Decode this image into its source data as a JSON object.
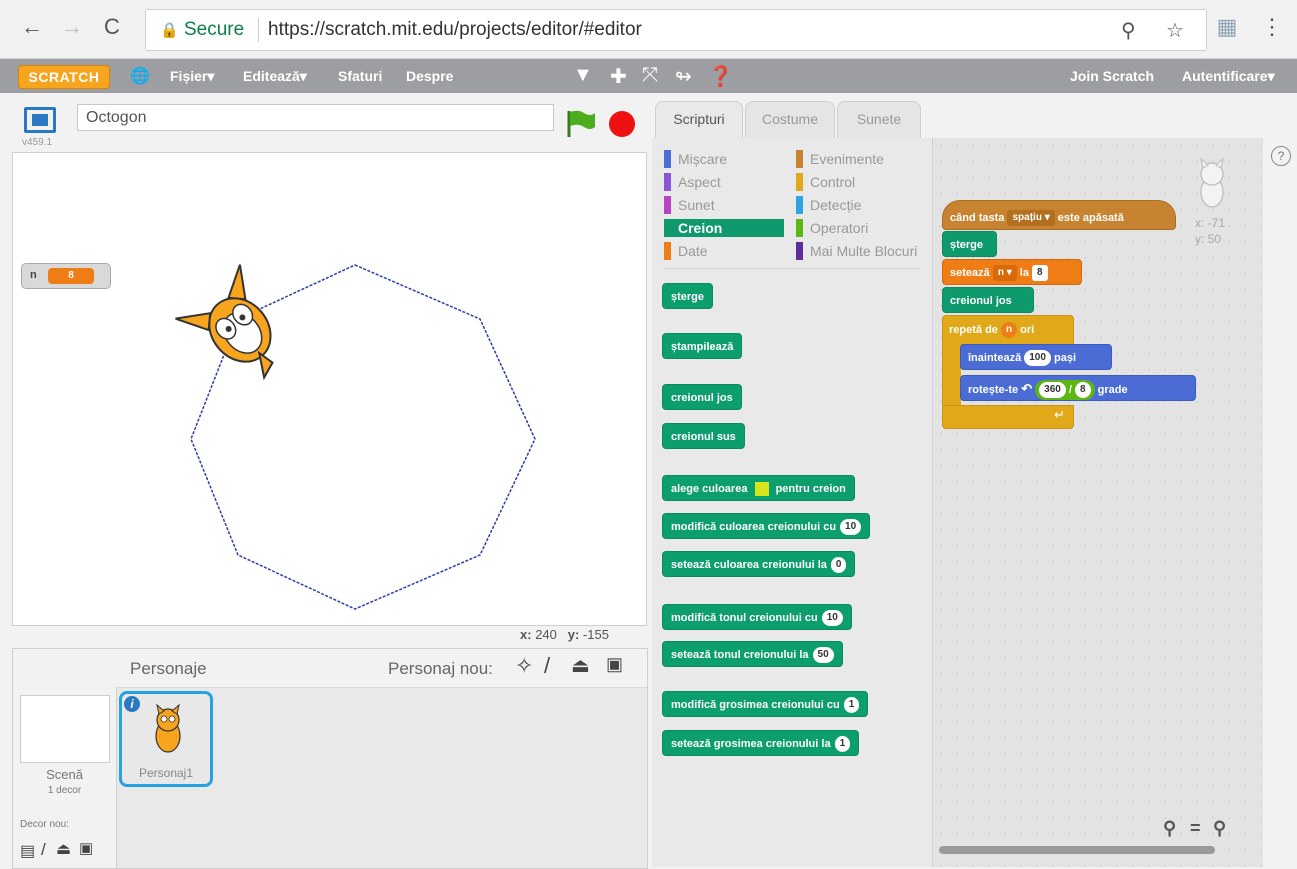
{
  "browser": {
    "back": "←",
    "forward": "→",
    "reload": "C",
    "secure_label": "Secure",
    "url": "https://scratch.mit.edu/projects/editor/#editor"
  },
  "menubar": {
    "logo": "SCRATCH",
    "items": [
      "Fișier▾",
      "Editează▾",
      "Sfaturi",
      "Despre"
    ],
    "join": "Join Scratch",
    "login": "Autentificare▾"
  },
  "stage": {
    "version": "v459.1",
    "project_title": "Octogon",
    "variable_name": "n",
    "variable_value": "8",
    "mouse_x_label": "x:",
    "mouse_x": "240",
    "mouse_y_label": "y:",
    "mouse_y": "-155"
  },
  "sprites": {
    "header": "Personaje",
    "new_sprite_label": "Personaj nou:",
    "scene_label": "Scenă",
    "scene_sub": "1 decor",
    "new_backdrop": "Decor nou:",
    "sprite_name": "Personaj1"
  },
  "tabs": [
    "Scripturi",
    "Costume",
    "Sunete"
  ],
  "categories": {
    "left": [
      "Mișcare",
      "Aspect",
      "Sunet",
      "Creion",
      "Date"
    ],
    "right": [
      "Evenimente",
      "Control",
      "Detecție",
      "Operatori",
      "Mai Multe Blocuri"
    ],
    "colors": {
      "Mișcare": "#4a6cd4",
      "Aspect": "#8a55d7",
      "Sunet": "#bb42c3",
      "Creion": "#0e9a6c",
      "Date": "#ee7d16",
      "Evenimente": "#c88330",
      "Control": "#e1a91a",
      "Detecție": "#2ca5e2",
      "Operatori": "#5cb712",
      "Mai Multe Blocuri": "#632d99"
    }
  },
  "pen_blocks": {
    "clear": "șterge",
    "stamp": "ștampilează",
    "pen_down": "creionul jos",
    "pen_up": "creionul sus",
    "set_color_pre": "alege culoarea",
    "set_color_post": "pentru creion",
    "change_color": "modifică culoarea creionului cu",
    "change_color_val": "10",
    "set_color_to": "setează culoarea creionului la",
    "set_color_to_val": "0",
    "change_shade": "modifică tonul creionului cu",
    "change_shade_val": "10",
    "set_shade": "setează tonul creionului la",
    "set_shade_val": "50",
    "change_size": "modifică grosimea creionului cu",
    "change_size_val": "1",
    "set_size": "setează grosimea creionului la",
    "set_size_val": "1"
  },
  "script": {
    "hat_pre": "când tasta",
    "hat_key": "spațiu ▾",
    "hat_post": "este apăsată",
    "clear": "șterge",
    "set_pre": "setează",
    "set_var": "n ▾",
    "set_mid": "la",
    "set_val": "8",
    "pen_down": "creionul jos",
    "repeat_pre": "repetă de",
    "repeat_var": "n",
    "repeat_post": "ori",
    "move_pre": "înaintează",
    "move_val": "100",
    "move_post": "pași",
    "turn_pre": "rotește-te",
    "turn_a": "360",
    "turn_op": "/",
    "turn_b": "8",
    "turn_post": "grade",
    "sprite_x": "x: -71",
    "sprite_y": "y: 50"
  },
  "colors": {
    "pen": "#0e9a6c",
    "events": "#c88330",
    "data": "#ee7d16",
    "control": "#e1a91a",
    "motion": "#4a6cd4",
    "operators": "#5cb712"
  }
}
